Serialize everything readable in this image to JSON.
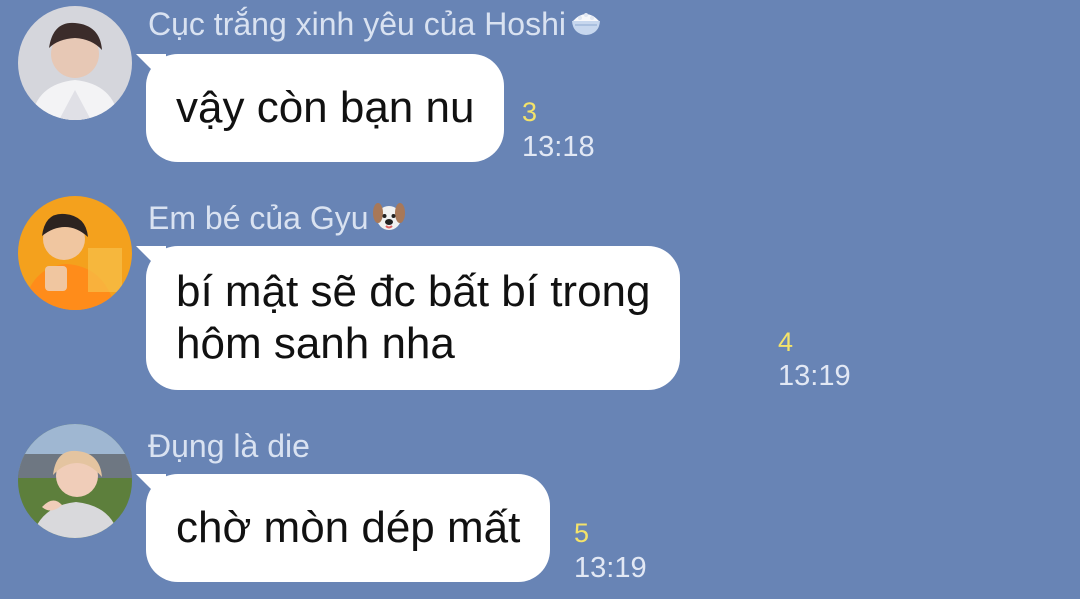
{
  "messages": [
    {
      "sender": "Cục trắng xinh yêu của Hoshi",
      "sender_emoji": "rice-bowl-emoji",
      "text": "vậy còn bạn nu",
      "read_count": "3",
      "time": "13:18"
    },
    {
      "sender": "Em bé của Gyu",
      "sender_emoji": "dog-face-emoji",
      "text": "bí mật sẽ đc bất bí trong\nhôm sanh nha",
      "lines": [
        "bí mật sẽ đc bất bí trong",
        "hôm sanh nha"
      ],
      "read_count": "4",
      "time": "13:19"
    },
    {
      "sender": "Đụng là die",
      "text": "chờ mòn dép mất",
      "read_count": "5",
      "time": "13:19"
    }
  ],
  "colors": {
    "background": "#6884b5",
    "bubble": "#ffffff",
    "read_count": "#f4e36a",
    "sender_name": "#d9e2f1",
    "timestamp": "#e2e8f4"
  },
  "icons": [
    "avatar-photo",
    "rice-bowl-emoji",
    "dog-face-emoji"
  ]
}
